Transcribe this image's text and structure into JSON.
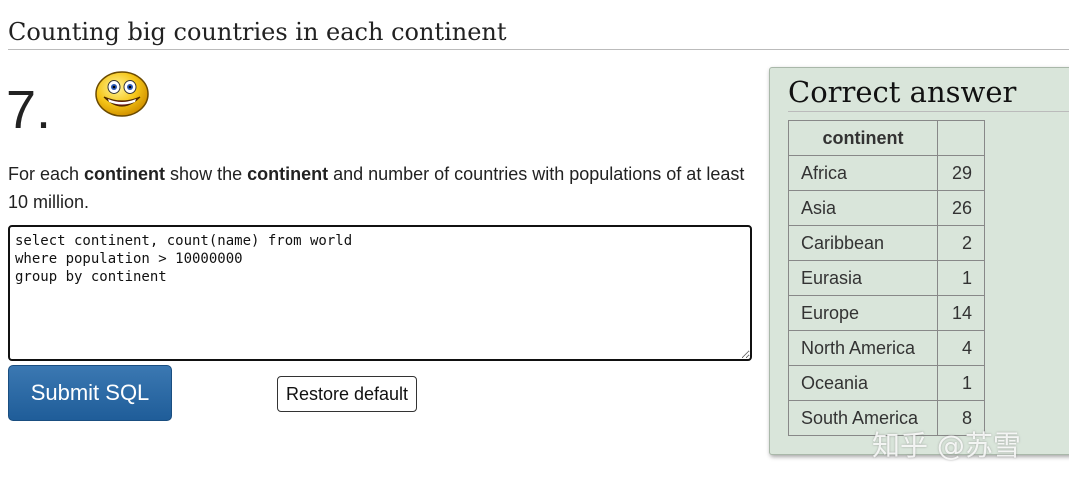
{
  "page": {
    "section_title": "Counting big countries in each continent",
    "question_number": "7.",
    "question": {
      "part1": "For each ",
      "bold1": "continent",
      "part2": " show the ",
      "bold2": "continent",
      "part3": " and number of countries with populations of at least 10 million."
    }
  },
  "editor": {
    "sql": "select continent, count(name) from world\nwhere population > 10000000\ngroup by continent"
  },
  "buttons": {
    "submit_label": "Submit SQL",
    "restore_label": "Restore default"
  },
  "answer": {
    "title": "Correct answer",
    "columns": [
      "continent",
      ""
    ],
    "rows": [
      {
        "continent": "Africa",
        "count": "29"
      },
      {
        "continent": "Asia",
        "count": "26"
      },
      {
        "continent": "Caribbean",
        "count": "2"
      },
      {
        "continent": "Eurasia",
        "count": "1"
      },
      {
        "continent": "Europe",
        "count": "14"
      },
      {
        "continent": "North America",
        "count": "4"
      },
      {
        "continent": "Oceania",
        "count": "1"
      },
      {
        "continent": "South America",
        "count": "8"
      }
    ]
  },
  "watermark": "知乎 @苏雪",
  "icons": {
    "smiley": "grinning-smiley-icon"
  },
  "colors": {
    "submit_button": "#2a6aa6",
    "answer_panel_bg": "#d9e5da",
    "smiley_face": "#f5c518"
  }
}
